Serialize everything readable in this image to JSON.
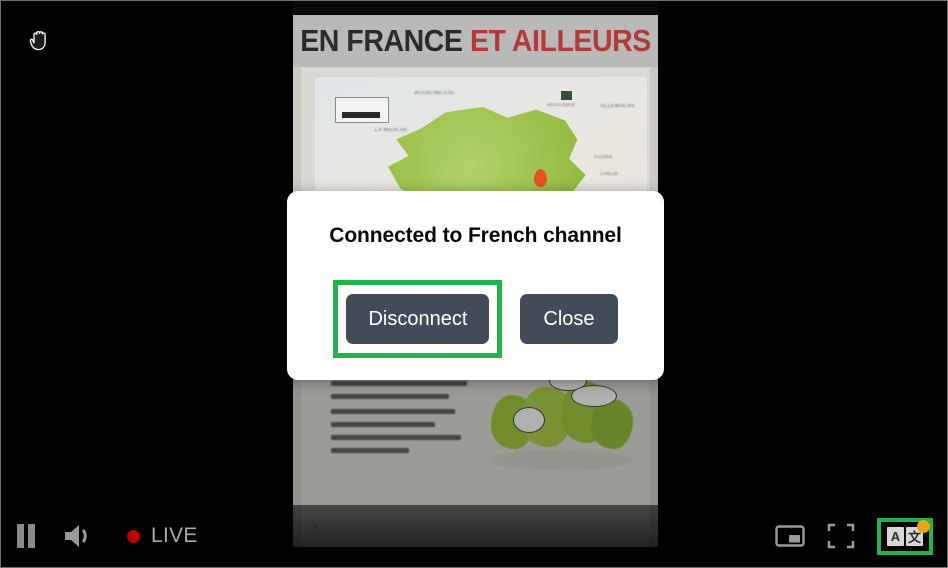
{
  "player": {
    "cursor_icon": "grab-hand-icon",
    "background_color": "#000000",
    "border_color": "#6e6e6e"
  },
  "video": {
    "title_part_dark": "EN FRANCE",
    "title_part_red": "ET AILLEURS",
    "title_dark_color": "#2b2b2b",
    "title_red_color": "#b33a3a",
    "content_description": "textbook page with map of France and exercise illustration",
    "page_number": "9"
  },
  "modal": {
    "title": "Connected to French channel",
    "disconnect_label": "Disconnect",
    "close_label": "Close",
    "button_color": "#414c58",
    "background_color": "#ffffff",
    "highlight_color": "#22b24c"
  },
  "controls": {
    "play_pause": {
      "icon": "pause-icon",
      "state": "playing"
    },
    "volume": {
      "icon": "volume-icon",
      "state": "on"
    },
    "live": {
      "label": "LIVE",
      "dot_color": "#c00000",
      "label_color": "#aaaaaa"
    },
    "picture_in_picture": {
      "icon": "picture-in-picture-icon"
    },
    "fullscreen": {
      "icon": "fullscreen-icon"
    },
    "translate": {
      "icon": "translate-icon",
      "latin_glyph": "A",
      "cjk_glyph": "文",
      "badge_color": "#e8a317",
      "highlighted": "true",
      "highlight_color": "#22b24c"
    }
  }
}
